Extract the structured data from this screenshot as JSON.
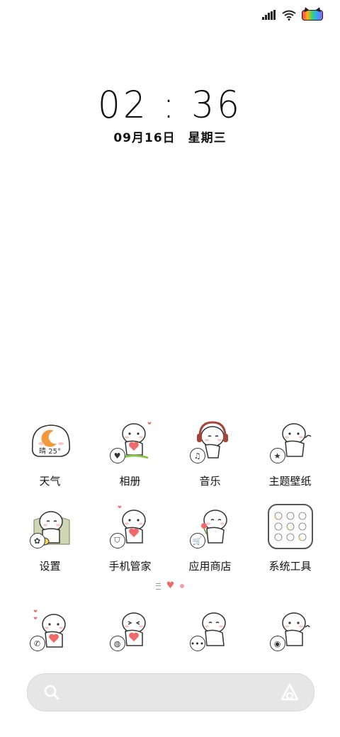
{
  "status_bar": {
    "signal_icon": "signal-bars-icon",
    "wifi_icon": "wifi-icon",
    "battery_icon": "cat-battery-icon"
  },
  "clock": {
    "time": "02 : 36",
    "date": "09月16日",
    "weekday": "星期三"
  },
  "weather_widget": {
    "text": "晴 25°"
  },
  "apps_row1": [
    {
      "label": "天气",
      "icon": "weather-moon-icon"
    },
    {
      "label": "相册",
      "icon": "gallery-heart-icon"
    },
    {
      "label": "音乐",
      "icon": "music-headphones-icon"
    },
    {
      "label": "主题壁纸",
      "icon": "themes-star-icon"
    }
  ],
  "apps_row2": [
    {
      "label": "设置",
      "icon": "settings-gear-icon"
    },
    {
      "label": "手机管家",
      "icon": "security-shield-icon"
    },
    {
      "label": "应用商店",
      "icon": "app-store-cart-icon"
    },
    {
      "label": "系统工具",
      "icon": "system-tools-folder-icon"
    }
  ],
  "dock": [
    {
      "icon": "phone-icon"
    },
    {
      "icon": "browser-icon"
    },
    {
      "icon": "messages-icon"
    },
    {
      "icon": "camera-icon"
    }
  ],
  "page_indicator": {
    "current": 2,
    "total": 3
  },
  "colors": {
    "heart": "#f06a6a",
    "moon": "#f39a3c",
    "search_bg": "#e6e6e6"
  }
}
